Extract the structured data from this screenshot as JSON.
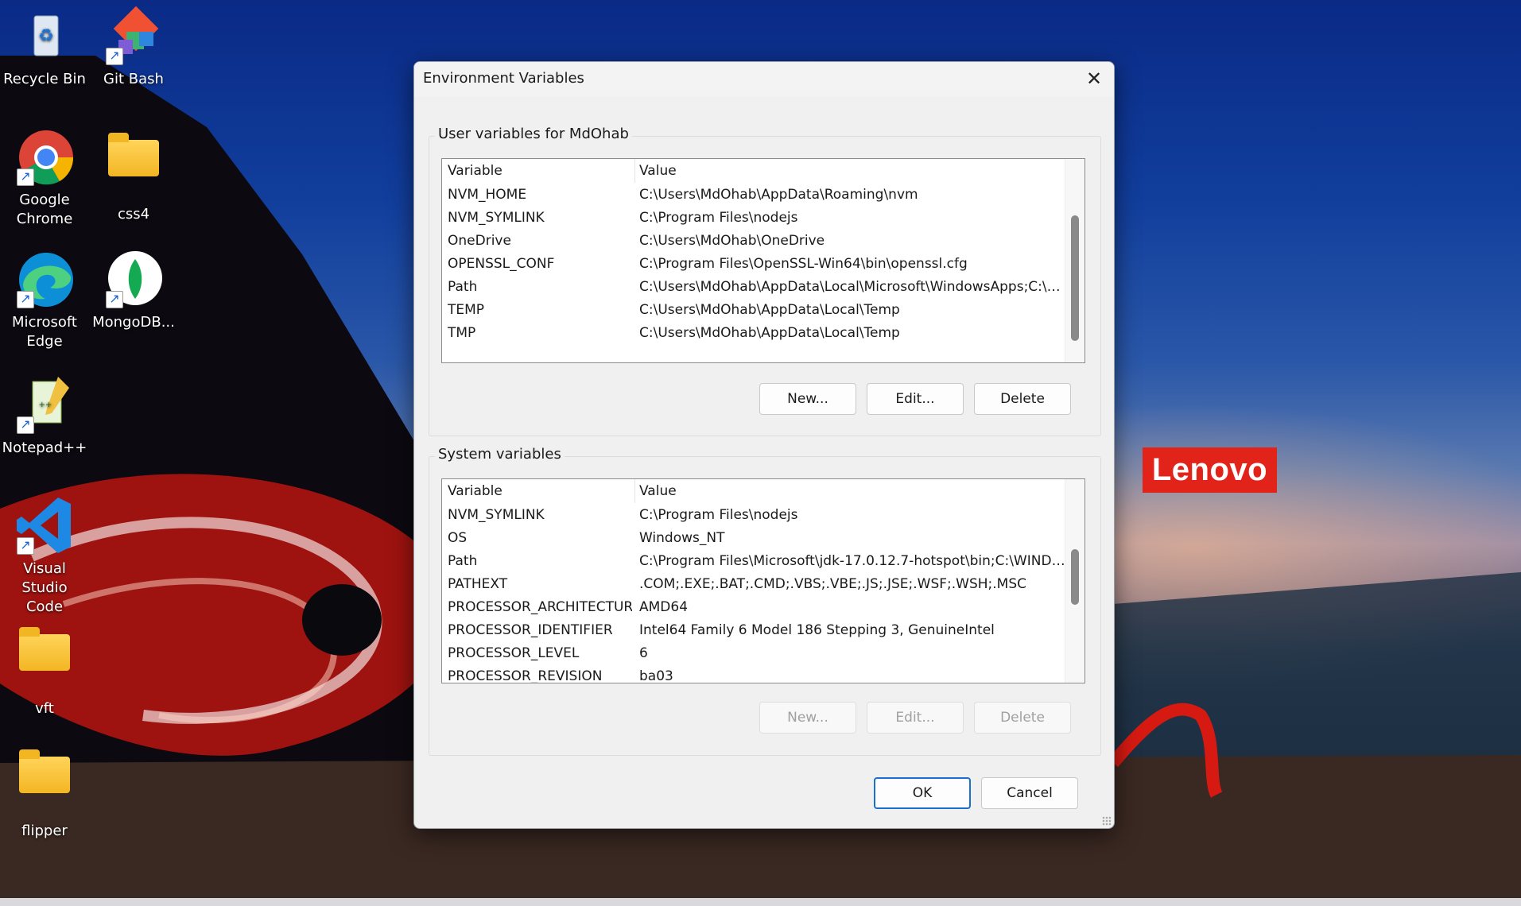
{
  "desktop": {
    "icons": [
      {
        "label": "Recycle Bin"
      },
      {
        "label": "Git Bash"
      },
      {
        "label": "Google Chrome"
      },
      {
        "label": "css4"
      },
      {
        "label": "Microsoft Edge"
      },
      {
        "label": "MongoDB..."
      },
      {
        "label": "Notepad++"
      },
      {
        "label": "Visual Studio Code"
      },
      {
        "label": "vft"
      },
      {
        "label": "flipper"
      }
    ],
    "brand_logo": "Lenovo"
  },
  "dialog": {
    "title": "Environment Variables",
    "close_icon": "close-icon",
    "user_section": {
      "label": "User variables for MdOhab",
      "col_variable": "Variable",
      "col_value": "Value",
      "rows": [
        {
          "name": "NVM_HOME",
          "value": "C:\\Users\\MdOhab\\AppData\\Roaming\\nvm"
        },
        {
          "name": "NVM_SYMLINK",
          "value": "C:\\Program Files\\nodejs"
        },
        {
          "name": "OneDrive",
          "value": "C:\\Users\\MdOhab\\OneDrive"
        },
        {
          "name": "OPENSSL_CONF",
          "value": "C:\\Program Files\\OpenSSL-Win64\\bin\\openssl.cfg"
        },
        {
          "name": "Path",
          "value": "C:\\Users\\MdOhab\\AppData\\Local\\Microsoft\\WindowsApps;C:\\U..."
        },
        {
          "name": "TEMP",
          "value": "C:\\Users\\MdOhab\\AppData\\Local\\Temp"
        },
        {
          "name": "TMP",
          "value": "C:\\Users\\MdOhab\\AppData\\Local\\Temp"
        }
      ],
      "new_label": "New...",
      "edit_label": "Edit...",
      "delete_label": "Delete"
    },
    "system_section": {
      "label": "System variables",
      "col_variable": "Variable",
      "col_value": "Value",
      "rows": [
        {
          "name": "NVM_SYMLINK",
          "value": "C:\\Program Files\\nodejs"
        },
        {
          "name": "OS",
          "value": "Windows_NT"
        },
        {
          "name": "Path",
          "value": "C:\\Program Files\\Microsoft\\jdk-17.0.12.7-hotspot\\bin;C:\\WINDO..."
        },
        {
          "name": "PATHEXT",
          "value": ".COM;.EXE;.BAT;.CMD;.VBS;.VBE;.JS;.JSE;.WSF;.WSH;.MSC"
        },
        {
          "name": "PROCESSOR_ARCHITECTURE",
          "value": "AMD64"
        },
        {
          "name": "PROCESSOR_IDENTIFIER",
          "value": "Intel64 Family 6 Model 186 Stepping 3, GenuineIntel"
        },
        {
          "name": "PROCESSOR_LEVEL",
          "value": "6"
        },
        {
          "name": "PROCESSOR_REVISION",
          "value": "ba03"
        }
      ],
      "new_label": "New...",
      "edit_label": "Edit...",
      "delete_label": "Delete"
    },
    "ok_label": "OK",
    "cancel_label": "Cancel"
  }
}
